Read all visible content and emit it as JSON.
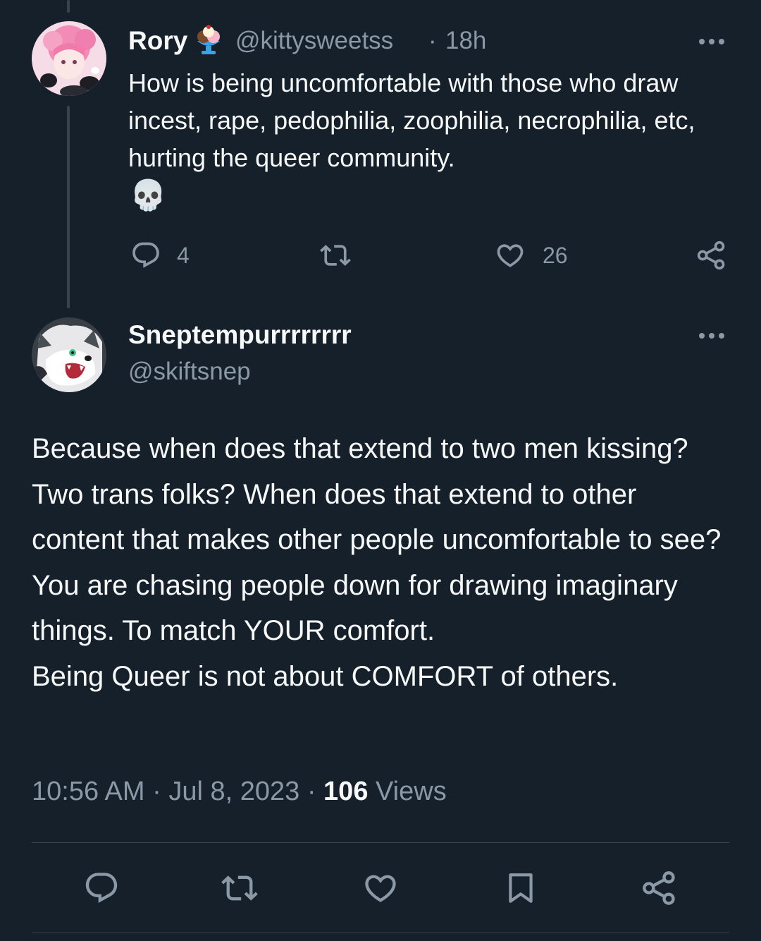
{
  "parent_tweet": {
    "author_name": "Rory",
    "handle": "@kittysweetss",
    "separator": "·",
    "time": "18h",
    "text": "How is being uncomfortable with those who draw incest, rape, pedophilia, zoophilia, necrophilia, etc, hurting the queer community.",
    "emoji": "💀",
    "reply_count": "4",
    "like_count": "26"
  },
  "main_tweet": {
    "author_name": "Sneptempurrrrrrrr",
    "handle": "@skiftsnep",
    "text_lines": [
      "Because when does that extend to two men kissing? Two trans folks? When does that extend to other content that makes other people uncomfortable to see?",
      "You are chasing people down for drawing imaginary things. To match YOUR comfort.",
      "Being Queer is not about COMFORT of others."
    ],
    "time": "10:56 AM",
    "date": "Jul 8, 2023",
    "separator": "·",
    "views_count": "106",
    "views_label": "Views"
  },
  "icons": {
    "reply": "reply-icon",
    "retweet": "retweet-icon",
    "like": "heart-icon",
    "bookmark": "bookmark-icon",
    "share": "share-icon",
    "more": "more-icon"
  },
  "colors": {
    "background": "#15202b",
    "text": "#f7f9f9",
    "muted": "#8b98a5",
    "divider": "#38444d"
  }
}
